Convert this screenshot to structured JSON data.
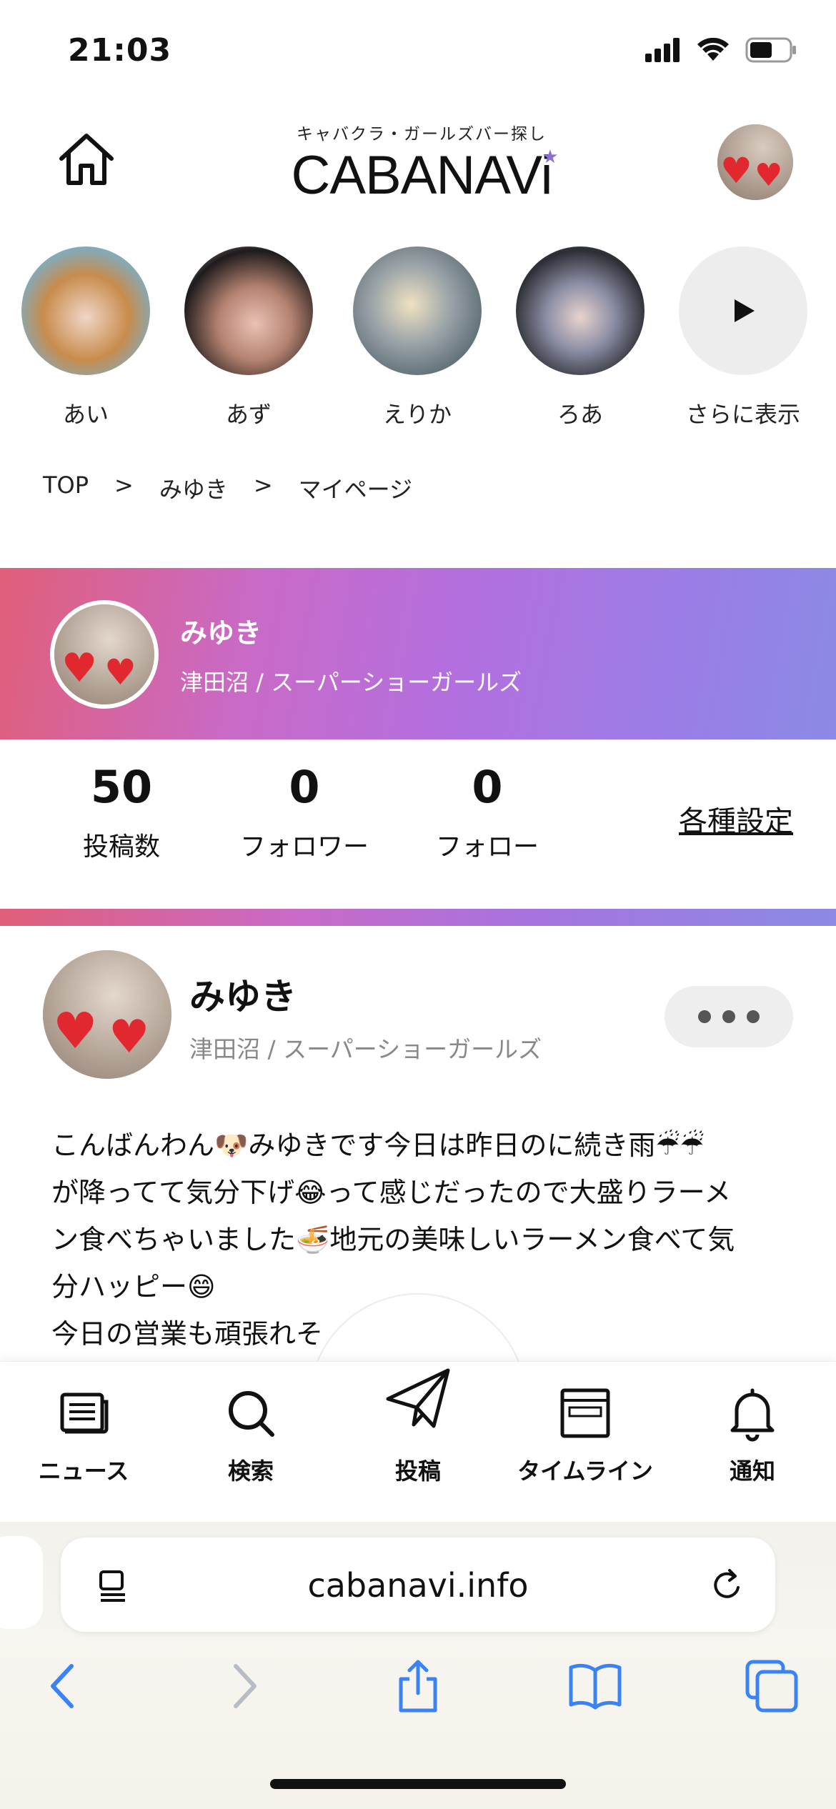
{
  "status_bar": {
    "time": "21:03"
  },
  "header": {
    "logo_tagline": "キャバクラ・ガールズバー探し",
    "logo_text": "CABANAVi"
  },
  "stories": [
    {
      "label": "あい"
    },
    {
      "label": "あず"
    },
    {
      "label": "えりか"
    },
    {
      "label": "ろあ"
    },
    {
      "label": "さらに表示"
    }
  ],
  "breadcrumb": {
    "items": [
      "TOP",
      "みゆき",
      "マイページ"
    ],
    "separator": ">"
  },
  "profile": {
    "name": "みゆき",
    "subtitle": "津田沼 / スーパーショーガールズ"
  },
  "stats": {
    "posts": {
      "value": "50",
      "label": "投稿数"
    },
    "followers": {
      "value": "0",
      "label": "フォロワー"
    },
    "following": {
      "value": "0",
      "label": "フォロー"
    },
    "settings_label": "各種設定"
  },
  "post": {
    "name": "みゆき",
    "subtitle": "津田沼 / スーパーショーガールズ",
    "lines": [
      "こんばんわん🐶みゆきです今日は昨日のに続き雨☔☔",
      "が降ってて気分下げ😂って感じだったので大盛りラーメ",
      "ン食べちゃいました🍜地元の美味しいラーメン食べて気",
      "分ハッピー😄",
      "今日の営業も頑張れそ"
    ]
  },
  "tabbar": {
    "tabs": [
      {
        "label": "ニュース",
        "icon": "news-icon"
      },
      {
        "label": "検索",
        "icon": "search-icon"
      },
      {
        "label": "投稿",
        "icon": "paper-plane-icon"
      },
      {
        "label": "タイムライン",
        "icon": "timeline-icon"
      },
      {
        "label": "通知",
        "icon": "bell-icon"
      }
    ]
  },
  "browser": {
    "url": "cabanavi.info"
  },
  "colors": {
    "banner_gradient_start": "#e05f79",
    "banner_gradient_mid": "#b36fdf",
    "banner_gradient_end": "#8b8ae6",
    "safari_blue": "#3a82f7"
  }
}
